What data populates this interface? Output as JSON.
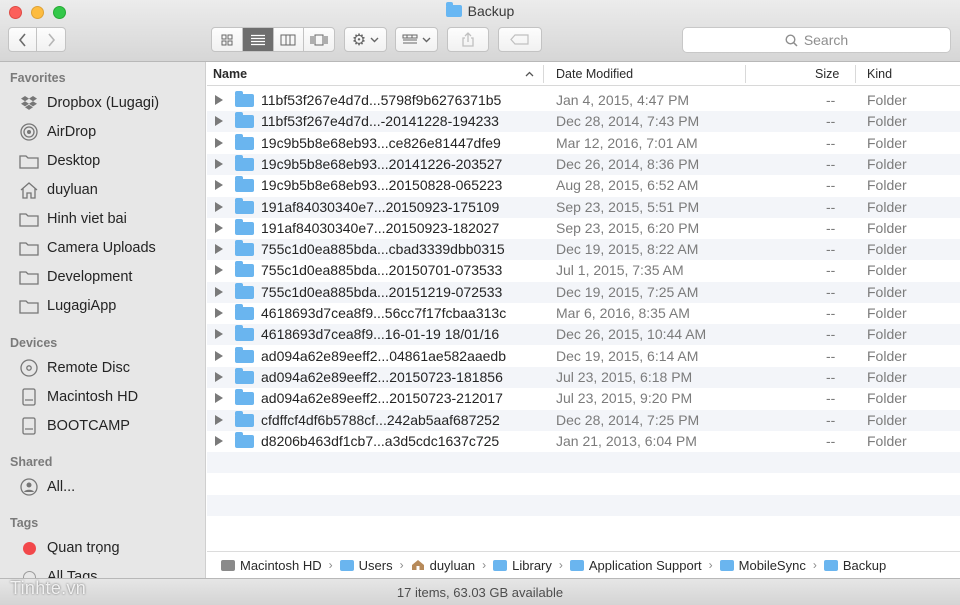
{
  "window": {
    "title": "Backup"
  },
  "toolbar": {
    "search_placeholder": "Search"
  },
  "sidebar": {
    "favorites_heading": "Favorites",
    "favorites": [
      {
        "label": "Dropbox (Lugagi)",
        "icon": "dropbox-icon"
      },
      {
        "label": "AirDrop",
        "icon": "airdrop-icon"
      },
      {
        "label": "Desktop",
        "icon": "folder-icon"
      },
      {
        "label": "duyluan",
        "icon": "home-icon"
      },
      {
        "label": "Hinh viet bai",
        "icon": "folder-icon"
      },
      {
        "label": "Camera Uploads",
        "icon": "folder-icon"
      },
      {
        "label": "Development",
        "icon": "folder-icon"
      },
      {
        "label": "LugagiApp",
        "icon": "folder-icon"
      }
    ],
    "devices_heading": "Devices",
    "devices": [
      {
        "label": "Remote Disc",
        "icon": "disc-icon"
      },
      {
        "label": "Macintosh HD",
        "icon": "hard-drive-icon"
      },
      {
        "label": "BOOTCAMP",
        "icon": "hard-drive-icon"
      }
    ],
    "shared_heading": "Shared",
    "shared": [
      {
        "label": "All...",
        "icon": "network-icon"
      }
    ],
    "tags_heading": "Tags",
    "tags": [
      {
        "label": "Quan trọng",
        "color": "#f2484b"
      },
      {
        "label": "All Tags...",
        "color": "#b8b8b8"
      }
    ]
  },
  "columns": {
    "name": "Name",
    "date": "Date Modified",
    "size": "Size",
    "kind": "Kind"
  },
  "files": [
    {
      "name": "11bf53f267e4d7d...5798f9b6276371b5",
      "date": "Jan 4, 2015, 4:47 PM",
      "size": "--",
      "kind": "Folder"
    },
    {
      "name": "11bf53f267e4d7d...-20141228-194233",
      "date": "Dec 28, 2014, 7:43 PM",
      "size": "--",
      "kind": "Folder"
    },
    {
      "name": "19c9b5b8e68eb93...ce826e81447dfe9",
      "date": "Mar 12, 2016, 7:01 AM",
      "size": "--",
      "kind": "Folder"
    },
    {
      "name": "19c9b5b8e68eb93...20141226-203527",
      "date": "Dec 26, 2014, 8:36 PM",
      "size": "--",
      "kind": "Folder"
    },
    {
      "name": "19c9b5b8e68eb93...20150828-065223",
      "date": "Aug 28, 2015, 6:52 AM",
      "size": "--",
      "kind": "Folder"
    },
    {
      "name": "191af84030340e7...20150923-175109",
      "date": "Sep 23, 2015, 5:51 PM",
      "size": "--",
      "kind": "Folder"
    },
    {
      "name": "191af84030340e7...20150923-182027",
      "date": "Sep 23, 2015, 6:20 PM",
      "size": "--",
      "kind": "Folder"
    },
    {
      "name": "755c1d0ea885bda...cbad3339dbb0315",
      "date": "Dec 19, 2015, 8:22 AM",
      "size": "--",
      "kind": "Folder"
    },
    {
      "name": "755c1d0ea885bda...20150701-073533",
      "date": "Jul 1, 2015, 7:35 AM",
      "size": "--",
      "kind": "Folder"
    },
    {
      "name": "755c1d0ea885bda...20151219-072533",
      "date": "Dec 19, 2015, 7:25 AM",
      "size": "--",
      "kind": "Folder"
    },
    {
      "name": "4618693d7cea8f9...56cc7f17fcbaa313c",
      "date": "Mar 6, 2016, 8:35 AM",
      "size": "--",
      "kind": "Folder"
    },
    {
      "name": "4618693d7cea8f9...16-01-19 18/01/16",
      "date": "Dec 26, 2015, 10:44 AM",
      "size": "--",
      "kind": "Folder"
    },
    {
      "name": "ad094a62e89eeff2...04861ae582aaedb",
      "date": "Dec 19, 2015, 6:14 AM",
      "size": "--",
      "kind": "Folder"
    },
    {
      "name": "ad094a62e89eeff2...20150723-181856",
      "date": "Jul 23, 2015, 6:18 PM",
      "size": "--",
      "kind": "Folder"
    },
    {
      "name": "ad094a62e89eeff2...20150723-212017",
      "date": "Jul 23, 2015, 9:20 PM",
      "size": "--",
      "kind": "Folder"
    },
    {
      "name": "cfdffcf4df6b5788cf...242ab5aaf687252",
      "date": "Dec 28, 2014, 7:25 PM",
      "size": "--",
      "kind": "Folder"
    },
    {
      "name": "d8206b463df1cb7...a3d5cdc1637c725",
      "date": "Jan 21, 2013, 6:04 PM",
      "size": "--",
      "kind": "Folder"
    }
  ],
  "pathbar": [
    {
      "label": "Macintosh HD",
      "icon": "hard-drive-icon"
    },
    {
      "label": "Users",
      "icon": "folder-icon"
    },
    {
      "label": "duyluan",
      "icon": "home-icon"
    },
    {
      "label": "Library",
      "icon": "folder-icon"
    },
    {
      "label": "Application Support",
      "icon": "folder-icon"
    },
    {
      "label": "MobileSync",
      "icon": "folder-icon"
    },
    {
      "label": "Backup",
      "icon": "folder-icon"
    }
  ],
  "status": {
    "text": "17 items, 63.03 GB available"
  },
  "watermark": "Tinhte.vn"
}
